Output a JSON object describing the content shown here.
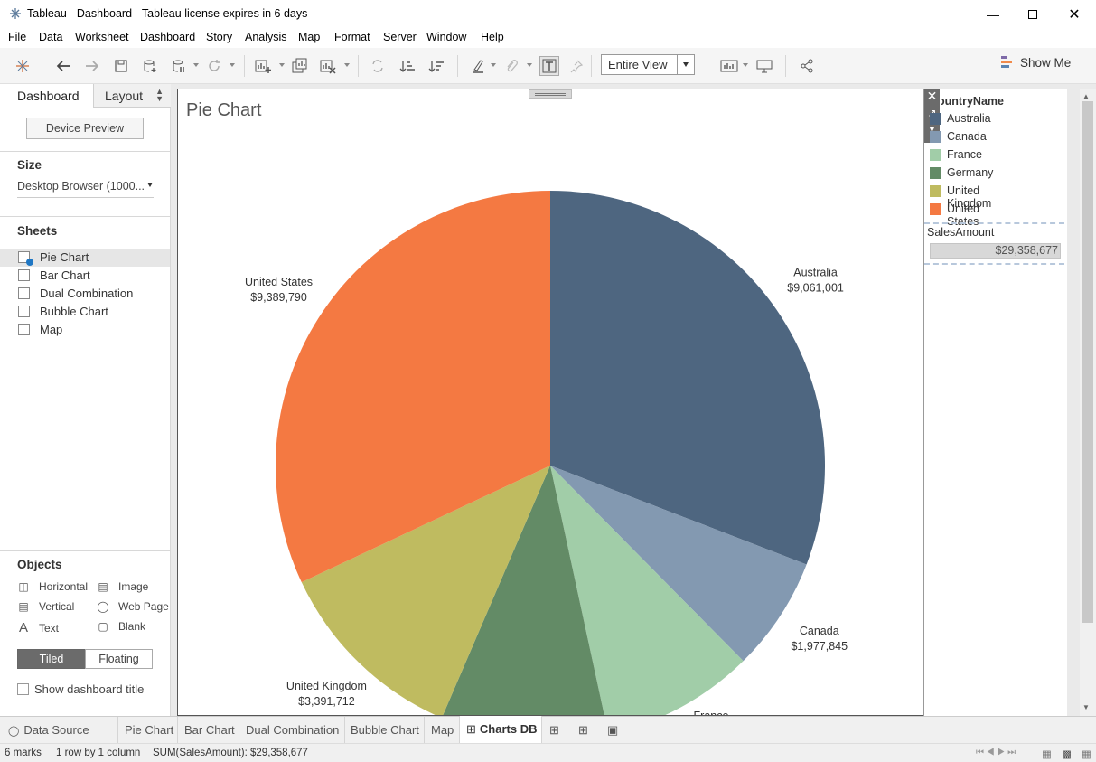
{
  "window": {
    "title": "Tableau - Dashboard - Tableau license expires in 6 days"
  },
  "menu": [
    "File",
    "Data",
    "Worksheet",
    "Dashboard",
    "Story",
    "Analysis",
    "Map",
    "Format",
    "Server",
    "Window",
    "Help"
  ],
  "toolbar": {
    "fit_select": "Entire View",
    "show_me": "Show Me"
  },
  "left_panel": {
    "tab_dashboard": "Dashboard",
    "tab_layout": "Layout",
    "device_preview": "Device Preview",
    "size_heading": "Size",
    "size_value": "Desktop Browser (1000...",
    "sheets_heading": "Sheets",
    "sheets": [
      "Pie Chart",
      "Bar Chart",
      "Dual Combination",
      "Bubble Chart",
      "Map"
    ],
    "objects_heading": "Objects",
    "objects": [
      "Horizontal",
      "Image",
      "Vertical",
      "Web Page",
      "Text",
      "Blank"
    ],
    "tiled": "Tiled",
    "floating": "Floating",
    "show_title": "Show dashboard title"
  },
  "dashboard": {
    "sheet_title": "Pie Chart"
  },
  "legend": {
    "title": "CountryName",
    "items": [
      {
        "label": "Australia",
        "color": "#4e6680"
      },
      {
        "label": "Canada",
        "color": "#8399b1"
      },
      {
        "label": "France",
        "color": "#a1cda8"
      },
      {
        "label": "Germany",
        "color": "#638b66"
      },
      {
        "label": "United Kingdom",
        "color": "#bfbb60"
      },
      {
        "label": "United States",
        "color": "#f47942"
      }
    ],
    "sales_label": "SalesAmount",
    "sales_value": "$29,358,677"
  },
  "chart_data": {
    "type": "pie",
    "title": "Pie Chart",
    "slices": [
      {
        "label": "Australia",
        "value": 9061001,
        "display": "$9,061,001",
        "color": "#4e6680"
      },
      {
        "label": "Canada",
        "value": 1977845,
        "display": "$1,977,845",
        "color": "#8399b1"
      },
      {
        "label": "France",
        "value": 2644017,
        "display": "",
        "color": "#a1cda8"
      },
      {
        "label": "Germany",
        "value": 2894312,
        "display": "",
        "color": "#638b66"
      },
      {
        "label": "United Kingdom",
        "value": 3391712,
        "display": "$3,391,712",
        "color": "#bfbb60"
      },
      {
        "label": "United States",
        "value": 9389790,
        "display": "$9,389,790",
        "color": "#f47942"
      }
    ],
    "partial_label": "France"
  },
  "tabs": [
    "Data Source",
    "Pie Chart",
    "Bar Chart",
    "Dual Combination",
    "Bubble Chart",
    "Map",
    "Charts DB"
  ],
  "status": {
    "marks": "6 marks",
    "layout": "1 row by 1 column",
    "sum": "SUM(SalesAmount): $29,358,677"
  }
}
